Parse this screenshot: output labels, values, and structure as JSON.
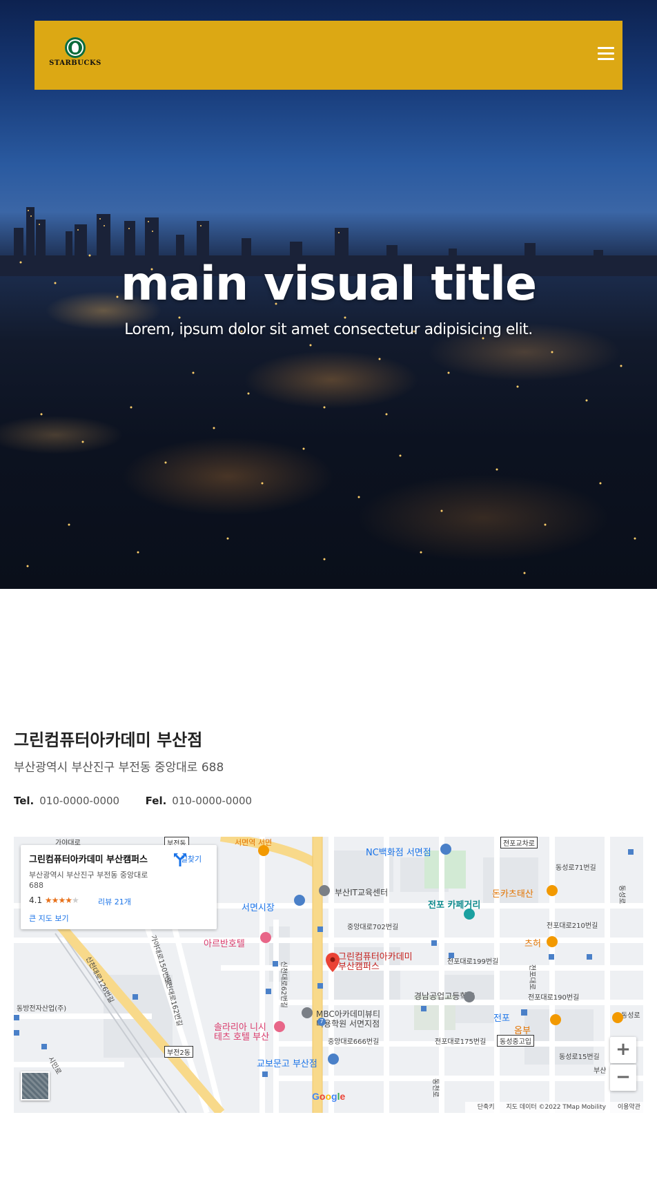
{
  "header": {
    "brand": "STARBUCKS"
  },
  "hero": {
    "title": "main visual title",
    "subtitle": "Lorem, ipsum dolor sit amet consectetur adipisicing elit."
  },
  "store": {
    "name": "그린컴퓨터아카데미 부산점",
    "address": "부산광역시 부산진구 부전동 중앙대로 688",
    "tel_label": "Tel.",
    "tel": "010-0000-0000",
    "fel_label": "Fel.",
    "fel": "010-0000-0000"
  },
  "map": {
    "card": {
      "name": "그린컴퓨터아카데미 부산캠퍼스",
      "address": "부산광역시 부산진구 부전동 중앙대로 688",
      "rating": "4.1",
      "stars": "★★★★",
      "star_off": "★",
      "reviews": "리뷰 21개",
      "larger_map": "큰 지도 보기",
      "directions": "길찾기"
    },
    "labels": {
      "nc_dept": "NC백화점 서면점",
      "edu_center": "부산IT교육센터",
      "seomyeon_market": "서면시장",
      "cafe_street": "전포 카페거리",
      "donkatsu": "돈카츠태산",
      "jungang702": "중앙대로702번길",
      "dongseong71": "동성로71번길",
      "jeonpo210": "전포대로210번길",
      "areban": "아르반호텔",
      "marker_line1": "그린컴퓨터아카데미",
      "marker_line2": "부산캠퍼스",
      "chuheo": "츠허",
      "jeonpo199": "전포대로199번길",
      "gyeongnam_school": "경남공업고등학교",
      "jeonpo190": "전포대로190번길",
      "mbc_line1": "MBC아카데미뷰티",
      "mbc_line2": "미용학원 서면지점",
      "jeonpo_station": "전포",
      "olbu": "옴부",
      "solaria_line1": "솔라리아 니시",
      "solaria_line2": "테츠 호텔 부산",
      "jungang666": "중앙대로666번길",
      "jeonpo175": "전포대로175번길",
      "dongseong_middle": "동성중고입",
      "dongseong15": "동성로15번길",
      "kyobo": "교보문고 부산점",
      "sinchun126": "신천대로126번길",
      "gaya150": "가야대로150번길",
      "sinchun162": "신천대로162번길",
      "sinchun62": "신천대로62번길",
      "busan_industry": "동방전자산업(주)",
      "bujeon2": "부전2동",
      "jeonpo_cross": "전포교차로",
      "bujeon_dong": "부전동",
      "gaya_road": "가야대로",
      "dongseongro": "동성로",
      "busan_short": "부산",
      "jeonpodae": "전포대로",
      "dongcheonro": "동천로",
      "sicheonro": "시민로",
      "route_7": "7",
      "dongseongro_right": "동성로",
      "seomyeon_top": "서면역 서면"
    },
    "zoom_in": "+",
    "zoom_out": "−",
    "google": "Google",
    "attribution": {
      "shortcuts": "단축키",
      "data": "지도 데이터 ©2022 TMap Mobility",
      "terms": "이용약관"
    }
  }
}
